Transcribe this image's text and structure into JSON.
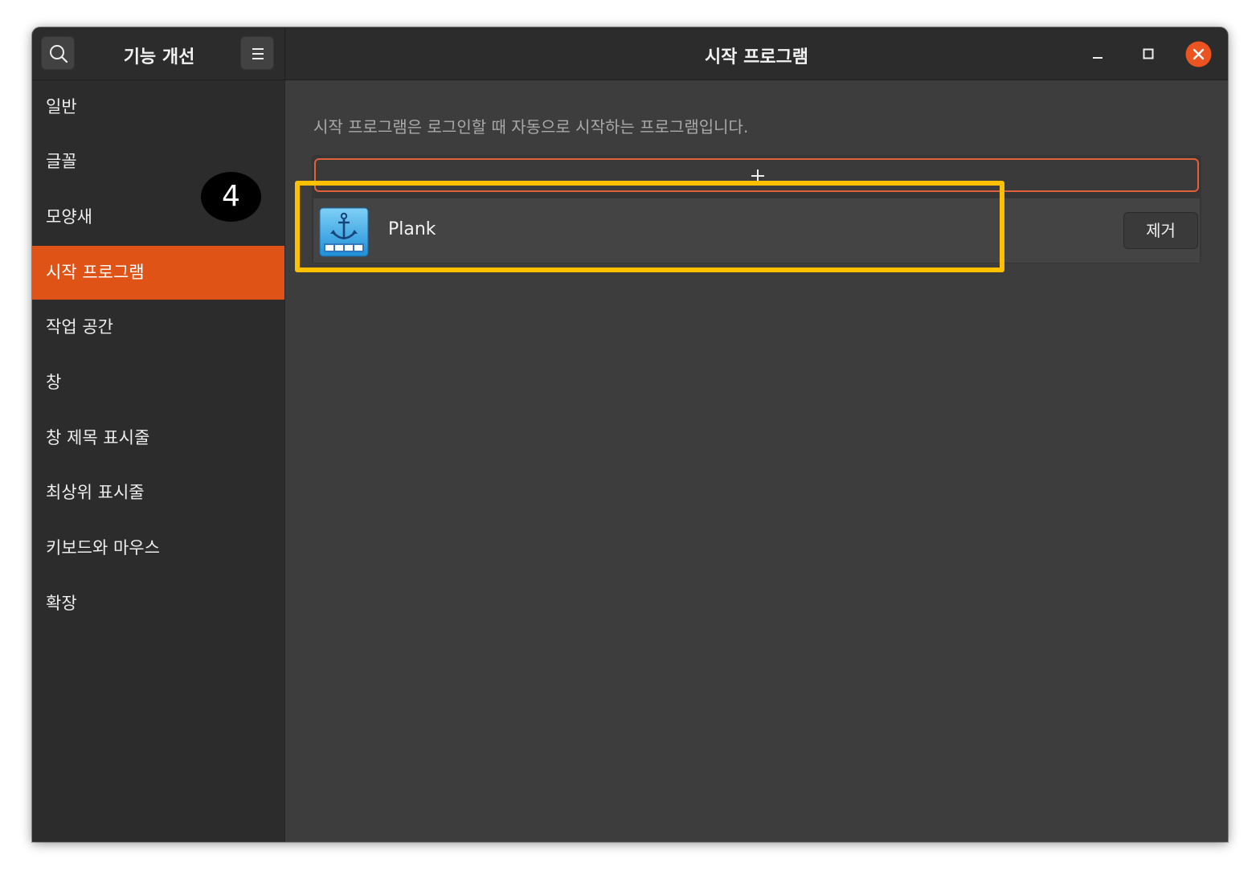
{
  "header": {
    "left_title": "기능 개선",
    "title": "시작 프로그램",
    "icons": {
      "search": "search-icon",
      "menu": "hamburger-menu-icon",
      "minimize": "minimize-icon",
      "maximize": "maximize-icon",
      "close": "close-icon"
    },
    "close_color": "#e95420"
  },
  "sidebar": {
    "items": [
      {
        "label": "일반"
      },
      {
        "label": "글꼴"
      },
      {
        "label": "모양새"
      },
      {
        "label": "시작 프로그램",
        "active": true
      },
      {
        "label": "작업 공간"
      },
      {
        "label": "창"
      },
      {
        "label": "창 제목 표시줄"
      },
      {
        "label": "최상위 표시줄"
      },
      {
        "label": "키보드와 마우스"
      },
      {
        "label": "확장"
      }
    ],
    "active_color": "#e05317"
  },
  "main": {
    "description": "시작 프로그램은 로그인할 때 자동으로 시작하는 프로그램입니다.",
    "add_icon": "plus-icon",
    "apps": [
      {
        "name": "Plank",
        "icon": "plank-anchor-icon",
        "remove_label": "제거"
      }
    ]
  },
  "overlay": {
    "step_number": "4",
    "highlight_color": "#ffc000"
  }
}
